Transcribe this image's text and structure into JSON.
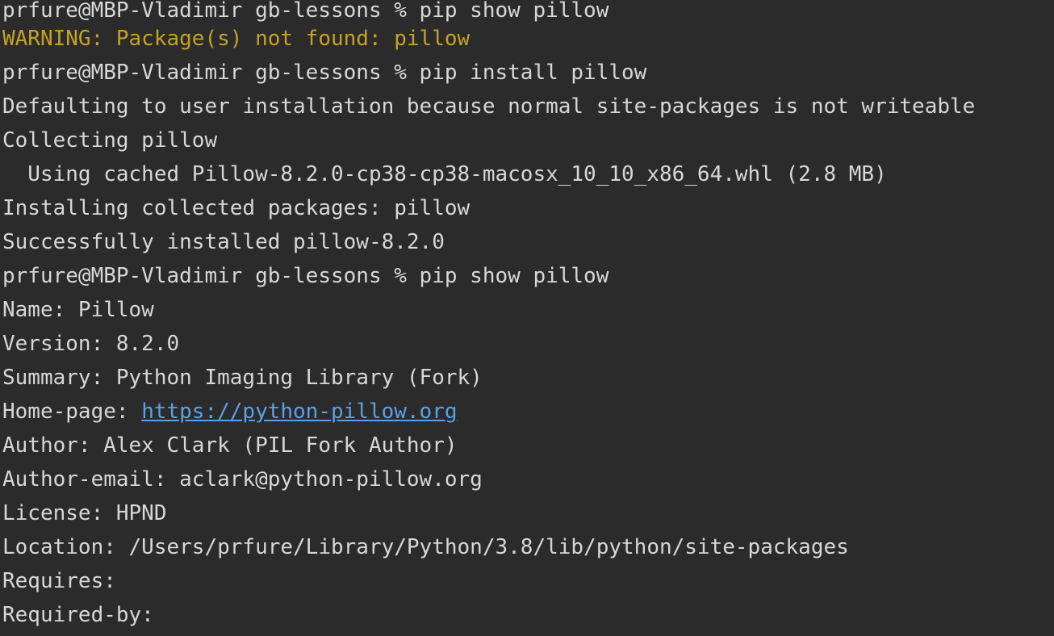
{
  "colors": {
    "background": "#2b2b2b",
    "foreground": "#d7d7d7",
    "warning": "#c6a126",
    "link": "#5aa0e8"
  },
  "terminal": {
    "line1": "prfure@MBP-Vladimir gb-lessons % pip show pillow",
    "line2": "WARNING: Package(s) not found: pillow",
    "line3": "prfure@MBP-Vladimir gb-lessons % pip install pillow",
    "line4": "Defaulting to user installation because normal site-packages is not writeable",
    "line5": "Collecting pillow",
    "line6": "  Using cached Pillow-8.2.0-cp38-cp38-macosx_10_10_x86_64.whl (2.8 MB)",
    "line7": "Installing collected packages: pillow",
    "line8": "Successfully installed pillow-8.2.0",
    "line9": "prfure@MBP-Vladimir gb-lessons % pip show pillow",
    "line10": "Name: Pillow",
    "line11": "Version: 8.2.0",
    "line12": "Summary: Python Imaging Library (Fork)",
    "line13_prefix": "Home-page: ",
    "line13_link": "https://python-pillow.org",
    "line14": "Author: Alex Clark (PIL Fork Author)",
    "line15": "Author-email: aclark@python-pillow.org",
    "line16": "License: HPND",
    "line17": "Location: /Users/prfure/Library/Python/3.8/lib/python/site-packages",
    "line18": "Requires:",
    "line19": "Required-by:"
  }
}
